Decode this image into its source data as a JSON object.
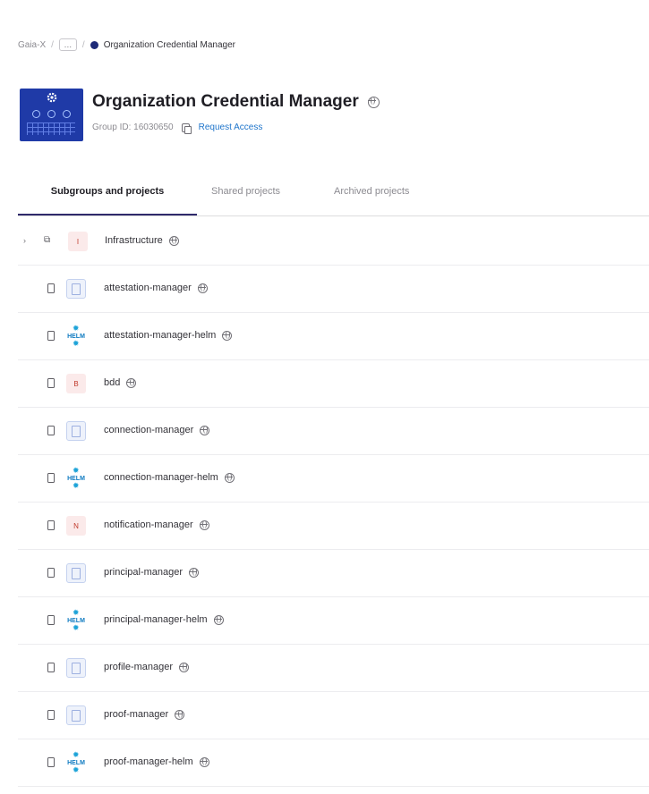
{
  "breadcrumb": {
    "root": "Gaia-X",
    "more": "…",
    "current": "Organization Credential Manager"
  },
  "group": {
    "name": "Organization Credential Manager",
    "id_label": "Group ID: 16030650",
    "request_access": "Request Access",
    "avatar_color": "#1f3aa7"
  },
  "tabs": [
    {
      "label": "Subgroups and projects",
      "active": true
    },
    {
      "label": "Shared projects",
      "active": false
    },
    {
      "label": "Archived projects",
      "active": false
    }
  ],
  "items": [
    {
      "type": "subgroup",
      "name": "Infrastructure",
      "avatar": "I",
      "avatar_kind": "letter"
    },
    {
      "type": "project",
      "name": "attestation-manager",
      "avatar": "",
      "avatar_kind": "doc"
    },
    {
      "type": "project",
      "name": "attestation-manager-helm",
      "avatar": "HELM",
      "avatar_kind": "helm"
    },
    {
      "type": "project",
      "name": "bdd",
      "avatar": "B",
      "avatar_kind": "letter"
    },
    {
      "type": "project",
      "name": "connection-manager",
      "avatar": "",
      "avatar_kind": "doc"
    },
    {
      "type": "project",
      "name": "connection-manager-helm",
      "avatar": "HELM",
      "avatar_kind": "helm"
    },
    {
      "type": "project",
      "name": "notification-manager",
      "avatar": "N",
      "avatar_kind": "letter"
    },
    {
      "type": "project",
      "name": "principal-manager",
      "avatar": "",
      "avatar_kind": "doc"
    },
    {
      "type": "project",
      "name": "principal-manager-helm",
      "avatar": "HELM",
      "avatar_kind": "helm"
    },
    {
      "type": "project",
      "name": "profile-manager",
      "avatar": "",
      "avatar_kind": "doc"
    },
    {
      "type": "project",
      "name": "proof-manager",
      "avatar": "",
      "avatar_kind": "doc"
    },
    {
      "type": "project",
      "name": "proof-manager-helm",
      "avatar": "HELM",
      "avatar_kind": "helm"
    }
  ],
  "icons": {
    "visibility": "globe-icon",
    "project": "project-icon",
    "subgroup": "subgroup-icon",
    "copy": "copy-icon",
    "expand": "chevron-right-icon"
  },
  "colors": {
    "link": "#1f75cb",
    "active_tab_underline": "#2f2a6b",
    "letter_avatar_bg": "#fbeaea"
  }
}
